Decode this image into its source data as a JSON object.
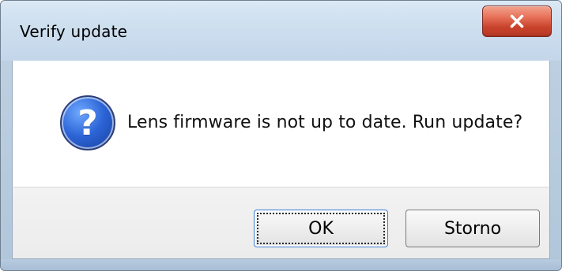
{
  "window": {
    "title": "Verify update",
    "close_icon": "close-icon"
  },
  "content": {
    "icon": "question-icon",
    "icon_glyph": "?",
    "message": "Lens firmware is not up to date. Run update?"
  },
  "buttons": {
    "ok_label": "OK",
    "cancel_label": "Storno"
  }
}
